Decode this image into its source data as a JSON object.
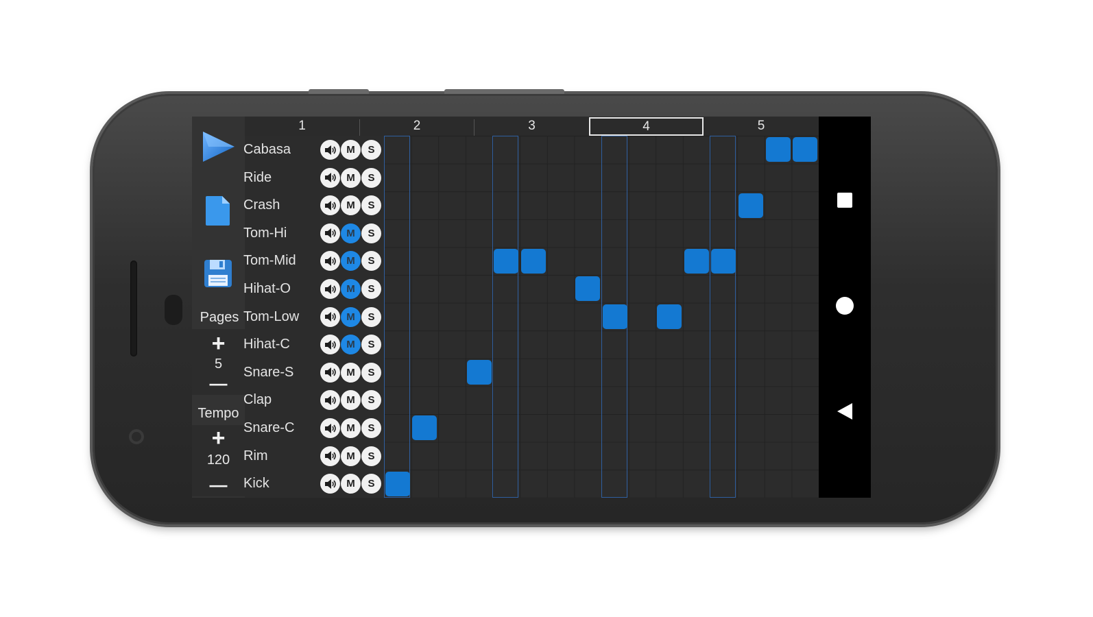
{
  "sidebar": {
    "pages_label": "Pages",
    "pages_value": "5",
    "tempo_label": "Tempo",
    "tempo_value": "120",
    "plus_symbol": "+",
    "minus_symbol": "—"
  },
  "timeline": {
    "pages": [
      "1",
      "2",
      "3",
      "4",
      "5"
    ],
    "selected_page": "4"
  },
  "tracks": [
    {
      "name": "Cabasa",
      "mute": false
    },
    {
      "name": "Ride",
      "mute": false
    },
    {
      "name": "Crash",
      "mute": false
    },
    {
      "name": "Tom-Hi",
      "mute": true
    },
    {
      "name": "Tom-Mid",
      "mute": true
    },
    {
      "name": "Hihat-O",
      "mute": true
    },
    {
      "name": "Tom-Low",
      "mute": true
    },
    {
      "name": "Hihat-C",
      "mute": true
    },
    {
      "name": "Snare-S",
      "mute": false
    },
    {
      "name": "Clap",
      "mute": false
    },
    {
      "name": "Snare-C",
      "mute": false
    },
    {
      "name": "Rim",
      "mute": false
    },
    {
      "name": "Kick",
      "mute": false
    }
  ],
  "controls": {
    "mute_label": "M",
    "solo_label": "S",
    "volume_icon": "speaker-icon"
  },
  "steps_per_row": 16,
  "active_steps": [
    {
      "track": "Cabasa",
      "steps": [
        14,
        15
      ]
    },
    {
      "track": "Crash",
      "steps": [
        13
      ]
    },
    {
      "track": "Tom-Mid",
      "steps": [
        4,
        5,
        11,
        12
      ]
    },
    {
      "track": "Hihat-O",
      "steps": [
        7
      ]
    },
    {
      "track": "Tom-Low",
      "steps": [
        8,
        10
      ]
    },
    {
      "track": "Snare-S",
      "steps": [
        3
      ]
    },
    {
      "track": "Snare-C",
      "steps": [
        1
      ]
    },
    {
      "track": "Kick",
      "steps": [
        0
      ]
    }
  ],
  "colors": {
    "accent": "#1479d2",
    "background": "#2c2c2c",
    "nav_bar": "#000000"
  },
  "nav": {
    "items": [
      "recent-apps-icon",
      "home-icon",
      "back-icon"
    ]
  }
}
